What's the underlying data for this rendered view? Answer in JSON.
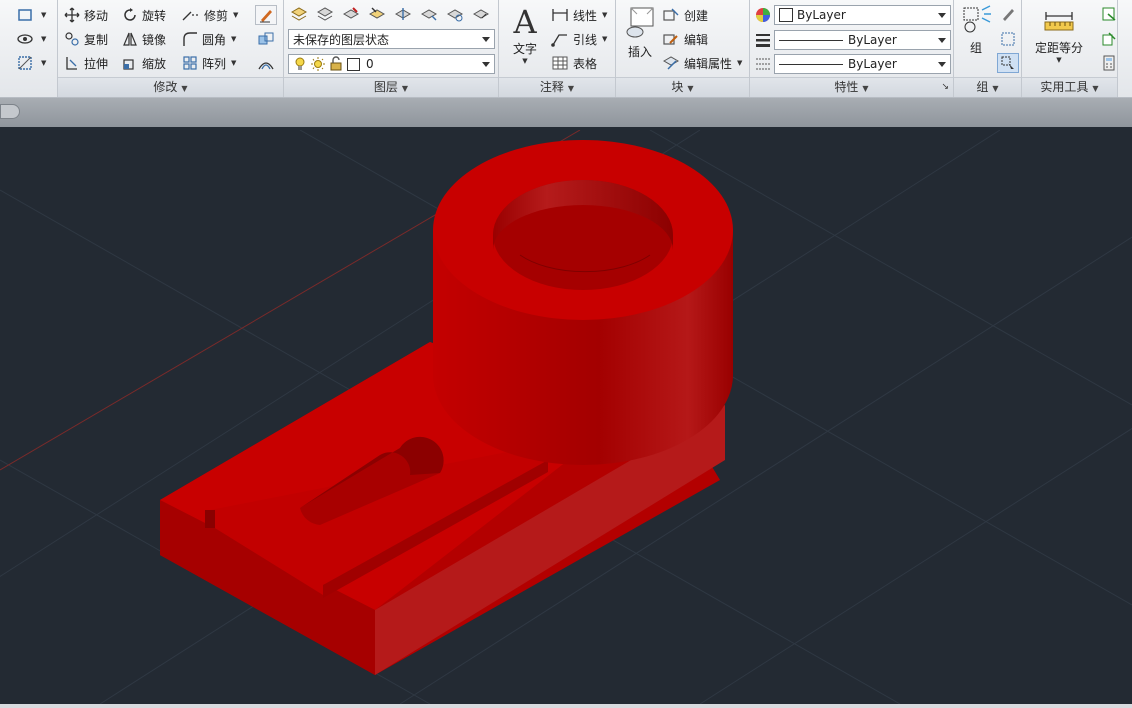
{
  "ribbon": {
    "modify": {
      "title": "修改",
      "move": "移动",
      "rotate": "旋转",
      "trim": "修剪",
      "copy": "复制",
      "mirror": "镜像",
      "fillet": "圆角",
      "stretch": "拉伸",
      "scale": "缩放",
      "array": "阵列"
    },
    "layers": {
      "title": "图层",
      "state_value": "未保存的图层状态",
      "current_layer": "0"
    },
    "annotation": {
      "title": "注释",
      "text": "文字",
      "linear": "线性",
      "leader": "引线",
      "table": "表格"
    },
    "block": {
      "title": "块",
      "insert": "插入",
      "create": "创建",
      "edit": "编辑",
      "edit_attributes": "编辑属性"
    },
    "properties": {
      "title": "特性",
      "color": "ByLayer",
      "lineweight": "ByLayer",
      "linetype": "ByLayer"
    },
    "groups": {
      "title": "组",
      "group": "组"
    },
    "utilities": {
      "title": "实用工具",
      "measure": "定距等分"
    }
  },
  "colors": {
    "model_red": "#c80000",
    "viewport_bg": "#232a33",
    "grid_line": "#2f3843",
    "axis_red": "#7a2a2a"
  },
  "icons": [
    "move-icon",
    "rotate-icon",
    "trim-icon",
    "copy-icon",
    "mirror-icon",
    "fillet-icon",
    "stretch-icon",
    "scale-icon",
    "array-icon",
    "text-icon",
    "linear-dimension-icon",
    "leader-icon",
    "table-icon",
    "insert-block-icon",
    "create-block-icon",
    "edit-block-icon",
    "edit-attributes-icon",
    "color-wheel-icon",
    "lineweight-icon",
    "linetype-icon",
    "group-icon",
    "measure-icon",
    "bulb-icon",
    "sun-icon",
    "lock-icon"
  ]
}
